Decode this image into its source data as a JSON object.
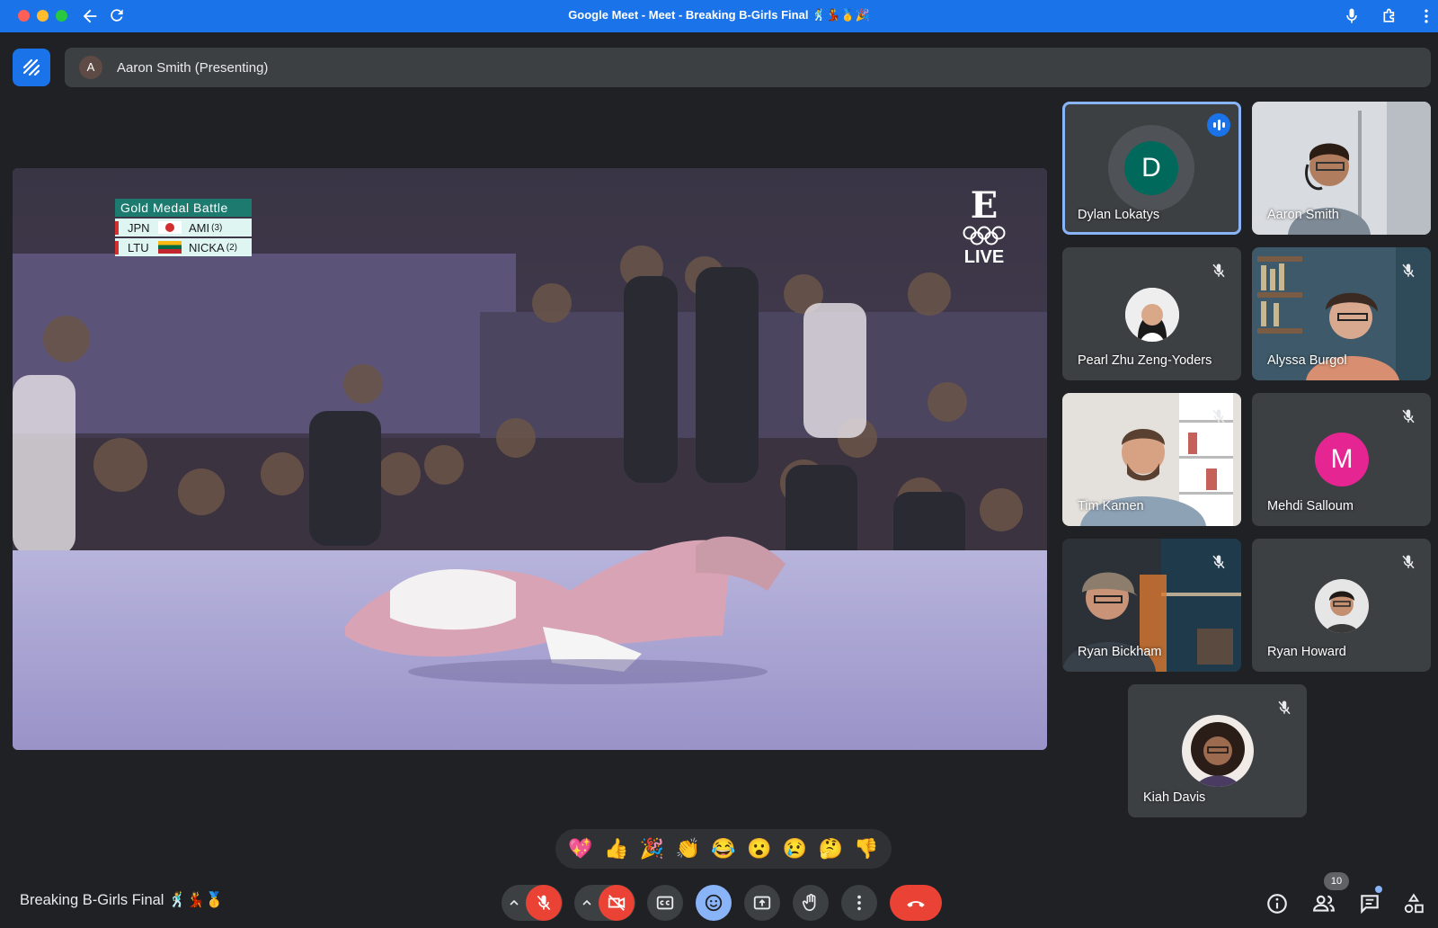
{
  "browser": {
    "title": "Google Meet - Meet - Breaking B-Girls Final 🕺💃🥇🎉",
    "icons": [
      "back-arrow-icon",
      "reload-icon",
      "microphone-icon",
      "extensions-icon",
      "kebab-menu-icon"
    ]
  },
  "presenting": {
    "avatar_letter": "A",
    "label": "Aaron Smith (Presenting)"
  },
  "shared_video": {
    "scoreboard": {
      "title": "Gold Medal Battle",
      "rows": [
        {
          "country": "JPN",
          "athlete": "AMI",
          "rank": "(3)"
        },
        {
          "country": "LTU",
          "athlete": "NICKA",
          "rank": "(2)"
        }
      ]
    },
    "broadcaster_logo": "E",
    "live_label": "LIVE"
  },
  "participants": [
    {
      "name": "Dylan Lokatys",
      "avatar_letter": "D",
      "avatar_color": "#00695c",
      "speaking": true,
      "muted": false
    },
    {
      "name": "Aaron Smith",
      "camera": true,
      "muted": false
    },
    {
      "name": "Pearl Zhu Zeng-Yoders",
      "photo": true,
      "muted": true
    },
    {
      "name": "Alyssa Burgol",
      "camera": true,
      "muted": true
    },
    {
      "name": "Tim Kamen",
      "camera": true,
      "muted": true
    },
    {
      "name": "Mehdi Salloum",
      "avatar_letter": "M",
      "avatar_color": "#e52592",
      "muted": true
    },
    {
      "name": "Ryan Bickham",
      "camera": true,
      "muted": true
    },
    {
      "name": "Ryan Howard",
      "photo": true,
      "muted": true
    },
    {
      "name": "Kiah Davis",
      "photo": true,
      "muted": true
    }
  ],
  "reactions": [
    "💖",
    "👍",
    "🎉",
    "👏",
    "😂",
    "😮",
    "😢",
    "🤔",
    "👎"
  ],
  "bottom_bar": {
    "meeting_title": "Breaking B-Girls Final 🕺💃🥇",
    "participant_count": "10"
  },
  "colors": {
    "accent": "#1a73e8",
    "danger": "#ea4335",
    "active_outline": "#8ab4f8",
    "surface": "#3c4043",
    "background": "#202124"
  }
}
